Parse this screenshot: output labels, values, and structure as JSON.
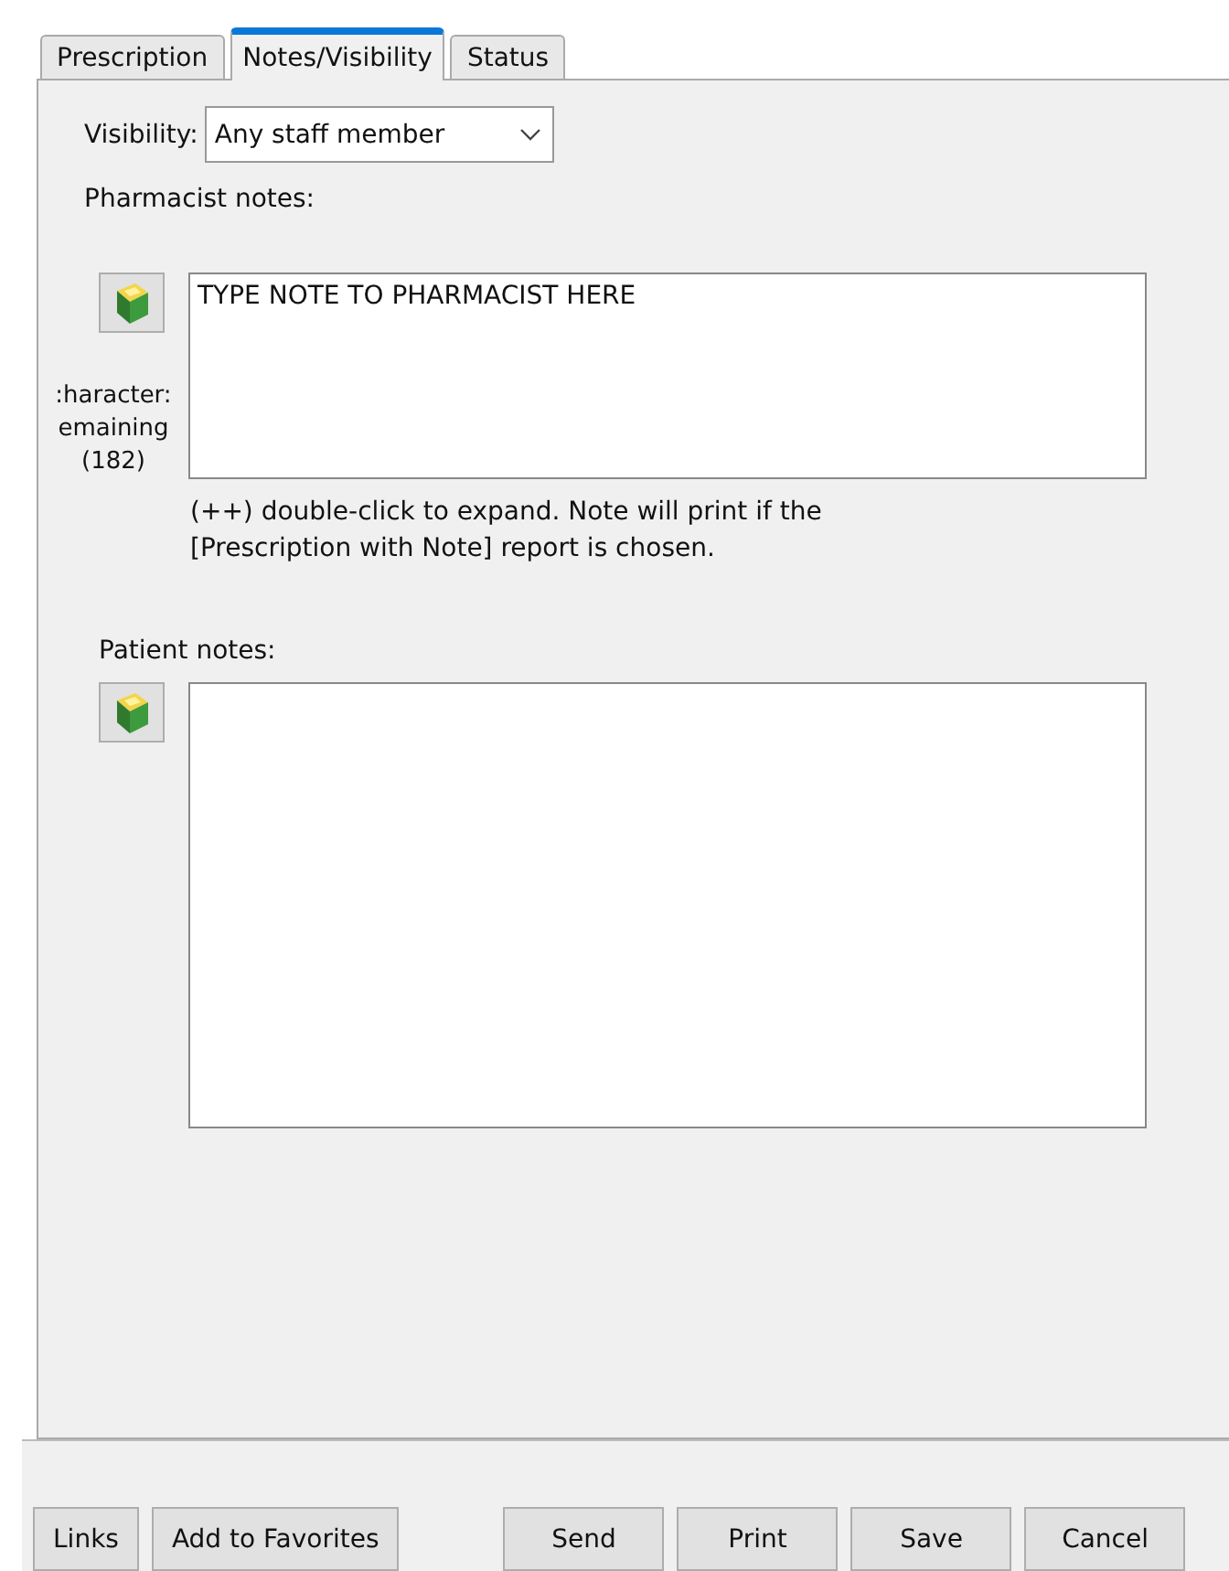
{
  "tabs": [
    {
      "label": "Prescription",
      "selected": false
    },
    {
      "label": "Notes/Visibility",
      "selected": true
    },
    {
      "label": "Status",
      "selected": false
    }
  ],
  "visibility": {
    "label": "Visibility:",
    "value": "Any staff member"
  },
  "pharmacist_notes": {
    "label": "Pharmacist notes:",
    "value": "TYPE NOTE TO PHARMACIST HERE",
    "counter": ":haracter:\nemaining\n(182)",
    "hint": "(++) double-click to expand. Note will print if the\n[Prescription with Note] report is chosen."
  },
  "patient_notes": {
    "label": "Patient notes:"
  },
  "left_buttons": [
    {
      "label": "Links"
    },
    {
      "label": "Add to Favorites"
    }
  ],
  "right_buttons": [
    {
      "label": "Send"
    },
    {
      "label": "Print"
    },
    {
      "label": "Save"
    },
    {
      "label": "Cancel"
    }
  ]
}
